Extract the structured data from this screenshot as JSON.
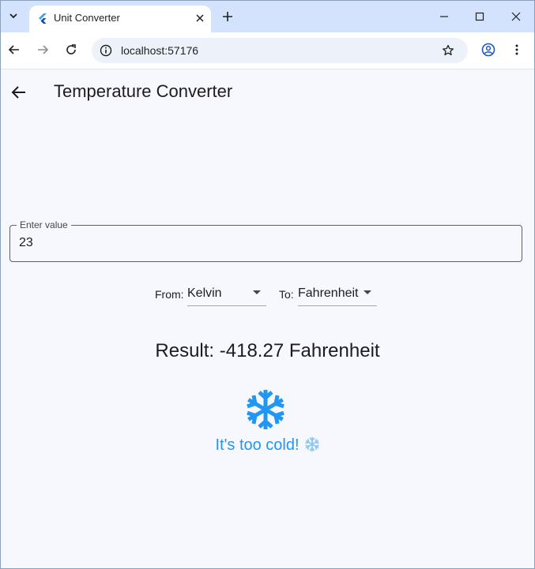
{
  "browser": {
    "tab_title": "Unit Converter",
    "url": "localhost:57176"
  },
  "app": {
    "title": "Temperature Converter",
    "input": {
      "label": "Enter value",
      "value": "23"
    },
    "from": {
      "prefix": "From:",
      "value": "Kelvin"
    },
    "to": {
      "prefix": "To:",
      "value": "Fahrenheit"
    },
    "result": "Result: -418.27 Fahrenheit",
    "message": "It's too cold!",
    "accent_color": "#2196f3",
    "message_icon": "snowflake-icon"
  }
}
